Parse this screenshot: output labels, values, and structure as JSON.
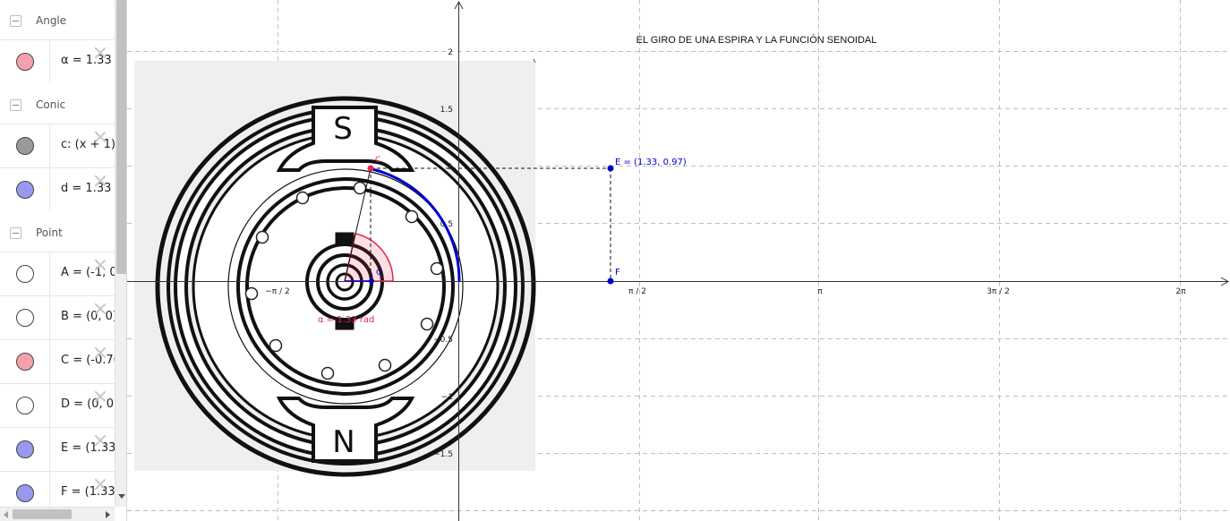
{
  "algebra_panel": {
    "groups": [
      {
        "label": "Angle"
      },
      {
        "label": "Conic"
      },
      {
        "label": "Point"
      }
    ],
    "items": [
      {
        "text": "α = 1.33 (",
        "color": "#f4a0ad"
      },
      {
        "text": "c: (x + 1)²",
        "color": "#9a9a9a"
      },
      {
        "text": "d = 1.33",
        "color": "#9898ee"
      },
      {
        "text": "A = (-1, 0)",
        "color": "#ffffff"
      },
      {
        "text": "B = (0, 0)",
        "color": "#ffffff"
      },
      {
        "text": "C = (-0.76",
        "color": "#f4a0ad"
      },
      {
        "text": "D = (0, 0)",
        "color": "#ffffff"
      },
      {
        "text": "E = (1.33",
        "color": "#9898ee"
      },
      {
        "text": "F = (1.33",
        "color": "#9898ee"
      }
    ]
  },
  "graphics": {
    "title": "EL GIRO DE UNA ESPIRA Y LA FUNCIÓN SENOIDAL",
    "x_ticks": [
      "−π / 2",
      "π / 2",
      "π",
      "3π / 2",
      "2π"
    ],
    "y_ticks": [
      "2",
      "1.5",
      "1",
      "0.5",
      "−0.5",
      "−1",
      "−1.5"
    ],
    "point_labels": {
      "E": "E = (1.33, 0.97)",
      "F": "F",
      "C": "C",
      "G": "G"
    },
    "angle_label": "α = 1.33 rad",
    "magnet_north": "N",
    "magnet_south": "S",
    "colors": {
      "blue": "#0000cc",
      "red": "#e8264d",
      "grid": "#bfbfbf"
    }
  }
}
